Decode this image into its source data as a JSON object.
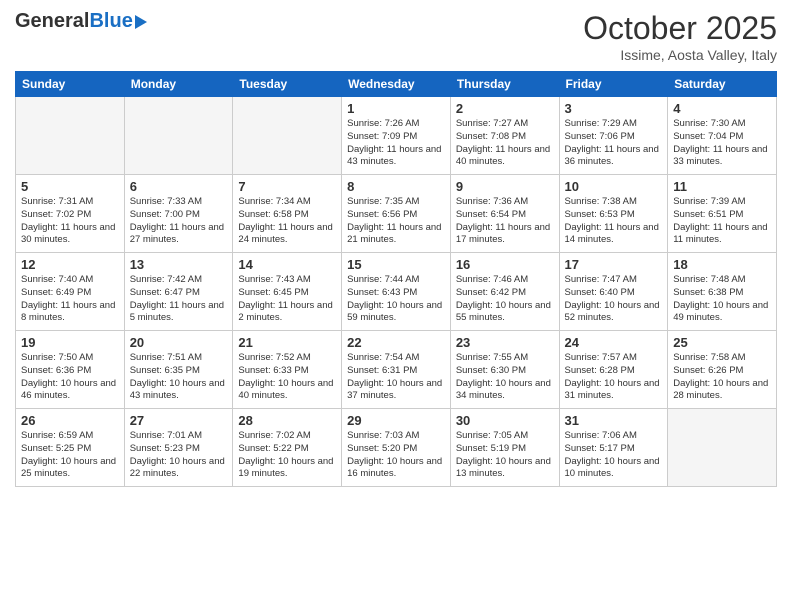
{
  "header": {
    "logo_general": "General",
    "logo_blue": "Blue",
    "month_title": "October 2025",
    "subtitle": "Issime, Aosta Valley, Italy"
  },
  "weekdays": [
    "Sunday",
    "Monday",
    "Tuesday",
    "Wednesday",
    "Thursday",
    "Friday",
    "Saturday"
  ],
  "weeks": [
    [
      {
        "day": "",
        "info": "",
        "empty": true
      },
      {
        "day": "",
        "info": "",
        "empty": true
      },
      {
        "day": "",
        "info": "",
        "empty": true
      },
      {
        "day": "1",
        "info": "Sunrise: 7:26 AM\nSunset: 7:09 PM\nDaylight: 11 hours\nand 43 minutes."
      },
      {
        "day": "2",
        "info": "Sunrise: 7:27 AM\nSunset: 7:08 PM\nDaylight: 11 hours\nand 40 minutes."
      },
      {
        "day": "3",
        "info": "Sunrise: 7:29 AM\nSunset: 7:06 PM\nDaylight: 11 hours\nand 36 minutes."
      },
      {
        "day": "4",
        "info": "Sunrise: 7:30 AM\nSunset: 7:04 PM\nDaylight: 11 hours\nand 33 minutes."
      }
    ],
    [
      {
        "day": "5",
        "info": "Sunrise: 7:31 AM\nSunset: 7:02 PM\nDaylight: 11 hours\nand 30 minutes."
      },
      {
        "day": "6",
        "info": "Sunrise: 7:33 AM\nSunset: 7:00 PM\nDaylight: 11 hours\nand 27 minutes."
      },
      {
        "day": "7",
        "info": "Sunrise: 7:34 AM\nSunset: 6:58 PM\nDaylight: 11 hours\nand 24 minutes."
      },
      {
        "day": "8",
        "info": "Sunrise: 7:35 AM\nSunset: 6:56 PM\nDaylight: 11 hours\nand 21 minutes."
      },
      {
        "day": "9",
        "info": "Sunrise: 7:36 AM\nSunset: 6:54 PM\nDaylight: 11 hours\nand 17 minutes."
      },
      {
        "day": "10",
        "info": "Sunrise: 7:38 AM\nSunset: 6:53 PM\nDaylight: 11 hours\nand 14 minutes."
      },
      {
        "day": "11",
        "info": "Sunrise: 7:39 AM\nSunset: 6:51 PM\nDaylight: 11 hours\nand 11 minutes."
      }
    ],
    [
      {
        "day": "12",
        "info": "Sunrise: 7:40 AM\nSunset: 6:49 PM\nDaylight: 11 hours\nand 8 minutes."
      },
      {
        "day": "13",
        "info": "Sunrise: 7:42 AM\nSunset: 6:47 PM\nDaylight: 11 hours\nand 5 minutes."
      },
      {
        "day": "14",
        "info": "Sunrise: 7:43 AM\nSunset: 6:45 PM\nDaylight: 11 hours\nand 2 minutes."
      },
      {
        "day": "15",
        "info": "Sunrise: 7:44 AM\nSunset: 6:43 PM\nDaylight: 10 hours\nand 59 minutes."
      },
      {
        "day": "16",
        "info": "Sunrise: 7:46 AM\nSunset: 6:42 PM\nDaylight: 10 hours\nand 55 minutes."
      },
      {
        "day": "17",
        "info": "Sunrise: 7:47 AM\nSunset: 6:40 PM\nDaylight: 10 hours\nand 52 minutes."
      },
      {
        "day": "18",
        "info": "Sunrise: 7:48 AM\nSunset: 6:38 PM\nDaylight: 10 hours\nand 49 minutes."
      }
    ],
    [
      {
        "day": "19",
        "info": "Sunrise: 7:50 AM\nSunset: 6:36 PM\nDaylight: 10 hours\nand 46 minutes."
      },
      {
        "day": "20",
        "info": "Sunrise: 7:51 AM\nSunset: 6:35 PM\nDaylight: 10 hours\nand 43 minutes."
      },
      {
        "day": "21",
        "info": "Sunrise: 7:52 AM\nSunset: 6:33 PM\nDaylight: 10 hours\nand 40 minutes."
      },
      {
        "day": "22",
        "info": "Sunrise: 7:54 AM\nSunset: 6:31 PM\nDaylight: 10 hours\nand 37 minutes."
      },
      {
        "day": "23",
        "info": "Sunrise: 7:55 AM\nSunset: 6:30 PM\nDaylight: 10 hours\nand 34 minutes."
      },
      {
        "day": "24",
        "info": "Sunrise: 7:57 AM\nSunset: 6:28 PM\nDaylight: 10 hours\nand 31 minutes."
      },
      {
        "day": "25",
        "info": "Sunrise: 7:58 AM\nSunset: 6:26 PM\nDaylight: 10 hours\nand 28 minutes."
      }
    ],
    [
      {
        "day": "26",
        "info": "Sunrise: 6:59 AM\nSunset: 5:25 PM\nDaylight: 10 hours\nand 25 minutes."
      },
      {
        "day": "27",
        "info": "Sunrise: 7:01 AM\nSunset: 5:23 PM\nDaylight: 10 hours\nand 22 minutes."
      },
      {
        "day": "28",
        "info": "Sunrise: 7:02 AM\nSunset: 5:22 PM\nDaylight: 10 hours\nand 19 minutes."
      },
      {
        "day": "29",
        "info": "Sunrise: 7:03 AM\nSunset: 5:20 PM\nDaylight: 10 hours\nand 16 minutes."
      },
      {
        "day": "30",
        "info": "Sunrise: 7:05 AM\nSunset: 5:19 PM\nDaylight: 10 hours\nand 13 minutes."
      },
      {
        "day": "31",
        "info": "Sunrise: 7:06 AM\nSunset: 5:17 PM\nDaylight: 10 hours\nand 10 minutes."
      },
      {
        "day": "",
        "info": "",
        "empty": true
      }
    ]
  ]
}
